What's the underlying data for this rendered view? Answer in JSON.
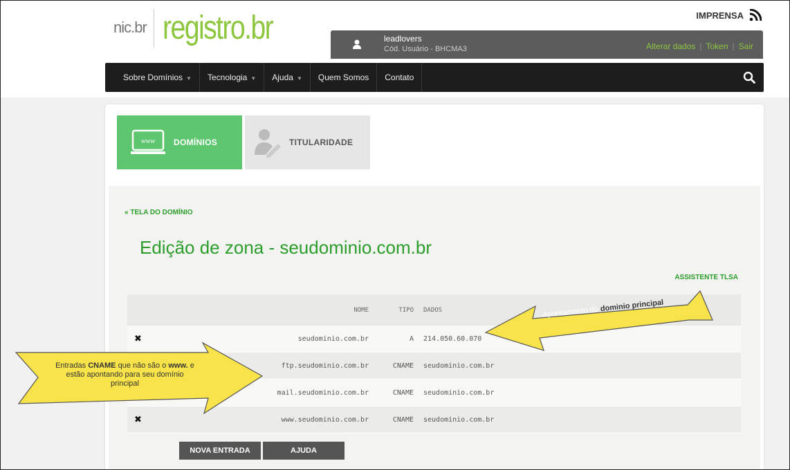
{
  "header": {
    "logo_nic": "nic.br",
    "logo_registro": "registro.br",
    "imprensa": "IMPRENSA",
    "user": {
      "name": "leadlovers",
      "code": "Cód. Usuário - BHCMA3",
      "links": [
        "Alterar dados",
        "Token",
        "Sair"
      ]
    }
  },
  "nav": {
    "items": [
      {
        "label": "Sobre Domínios",
        "dropdown": true
      },
      {
        "label": "Tecnologia",
        "dropdown": true
      },
      {
        "label": "Ajuda",
        "dropdown": true
      },
      {
        "label": "Quem Somos",
        "dropdown": false
      },
      {
        "label": "Contato",
        "dropdown": false
      }
    ]
  },
  "tabs": {
    "dominios": "DOMÍNIOS",
    "titularidade": "TITULARIDADE",
    "www_icon_text": "www"
  },
  "page": {
    "back_link": "« TELA DO DOMÍNIO",
    "title": "Edição de zona - seudominio.com.br",
    "tlsa_link": "ASSISTENTE TLSA"
  },
  "table": {
    "headers": {
      "nome": "NOME",
      "tipo": "TIPO",
      "dados": "DADOS"
    },
    "rows": [
      {
        "nome": "seudominio.com.br",
        "tipo": "A",
        "dados": "214.050.60.070"
      },
      {
        "nome": "ftp.seudominio.com.br",
        "tipo": "CNAME",
        "dados": "seudominio.com.br"
      },
      {
        "nome": "mail.seudominio.com.br",
        "tipo": "CNAME",
        "dados": "seudominio.com.br"
      },
      {
        "nome": "www.seudominio.com.br",
        "tipo": "CNAME",
        "dados": "seudominio.com.br"
      }
    ]
  },
  "buttons": {
    "nova_entrada": "NOVA ENTRADA",
    "ajuda": "AJUDA"
  },
  "callouts": {
    "right_prefix": "Apontamento do ",
    "right_bold": "dominio principal",
    "left_a": "Entradas ",
    "left_b": "CNAME",
    "left_c": " que não são o ",
    "left_d": "www.",
    "left_e": " e",
    "left_f": "estão apontando para seu domínio",
    "left_g": "principal"
  },
  "colors": {
    "accent_green": "#8dc63f",
    "link_green": "#2a9d2a",
    "tab_green": "#5dc66f",
    "navbar": "#1d1d1d",
    "callout_yellow": "#f8e34a"
  }
}
